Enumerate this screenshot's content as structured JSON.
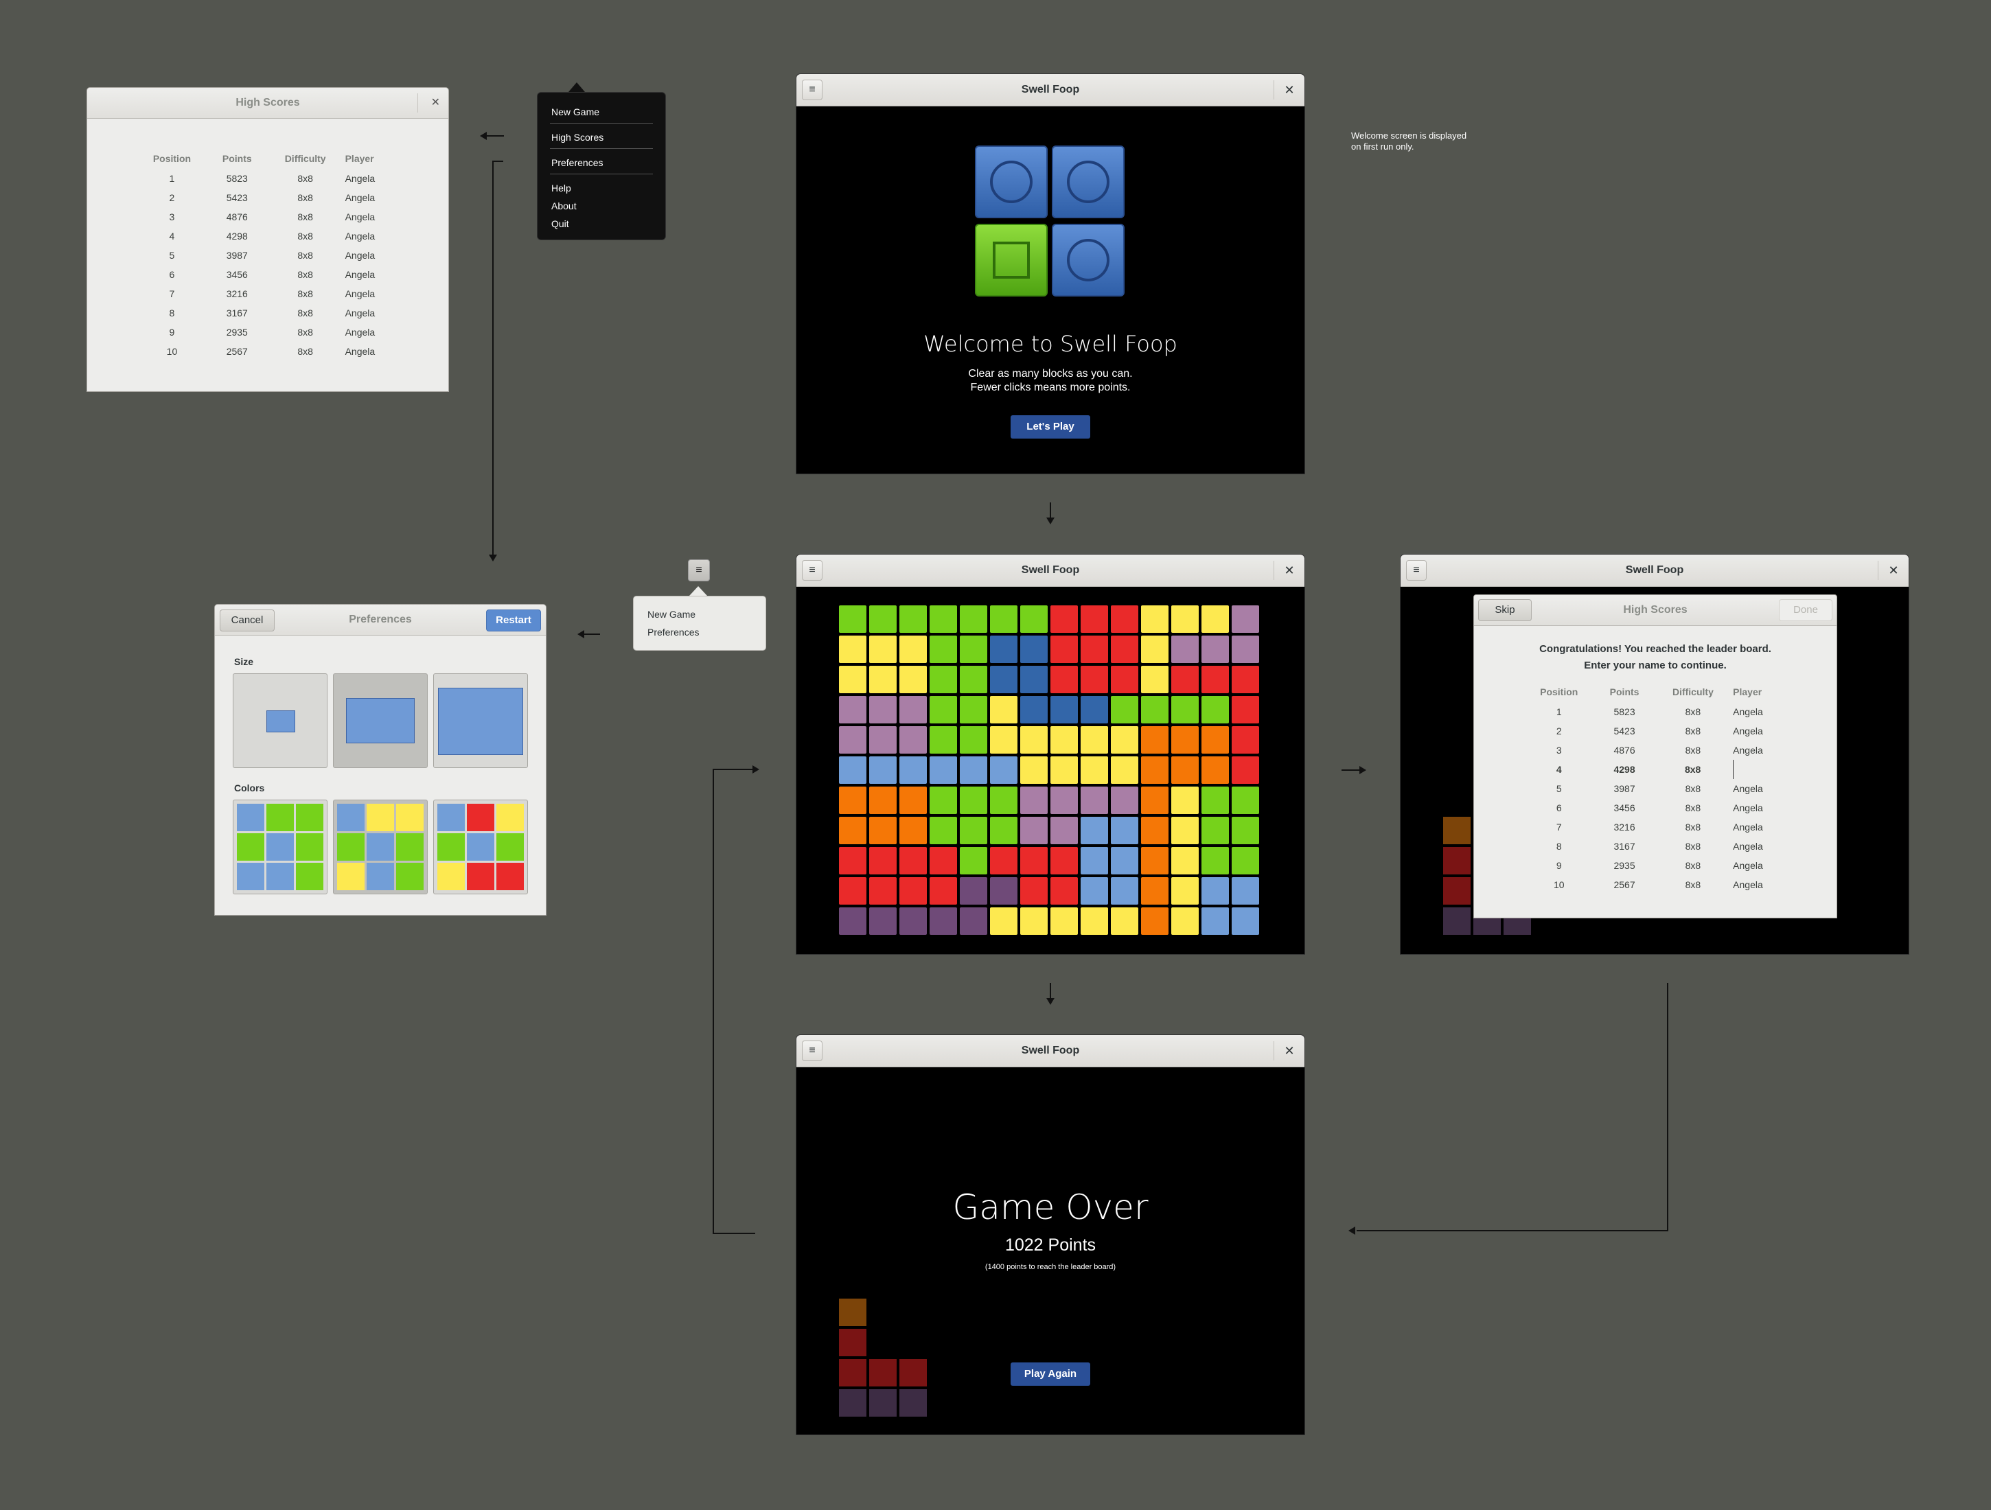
{
  "app": {
    "title": "Swell Foop"
  },
  "colors": {
    "green": "#76d21b",
    "blue": "#3366a9",
    "red": "#ea2a2a",
    "yellow": "#fde950",
    "purple": "#a97ea6",
    "lightblue": "#729ed7",
    "orange": "#f57706",
    "accent": "#2a4f97"
  },
  "main_menu": {
    "items": [
      "New Game",
      "High Scores",
      "Preferences",
      "Help",
      "About",
      "Quit"
    ]
  },
  "small_menu": {
    "items": [
      "New Game",
      "Preferences"
    ]
  },
  "high_scores": {
    "title": "High Scores",
    "columns": [
      "Position",
      "Points",
      "Difficulty",
      "Player"
    ],
    "rows": [
      [
        "1",
        "5823",
        "8x8",
        "Angela"
      ],
      [
        "2",
        "5423",
        "8x8",
        "Angela"
      ],
      [
        "3",
        "4876",
        "8x8",
        "Angela"
      ],
      [
        "4",
        "4298",
        "8x8",
        "Angela"
      ],
      [
        "5",
        "3987",
        "8x8",
        "Angela"
      ],
      [
        "6",
        "3456",
        "8x8",
        "Angela"
      ],
      [
        "7",
        "3216",
        "8x8",
        "Angela"
      ],
      [
        "8",
        "3167",
        "8x8",
        "Angela"
      ],
      [
        "9",
        "2935",
        "8x8",
        "Angela"
      ],
      [
        "10",
        "2567",
        "8x8",
        "Angela"
      ]
    ]
  },
  "welcome": {
    "heading": "Welcome to Swell Foop",
    "line1": "Clear as many blocks as you can.",
    "line2": "Fewer clicks means more points.",
    "button": "Let's Play"
  },
  "note": {
    "line1": "Welcome screen is displayed",
    "line2": "on first run only."
  },
  "preferences": {
    "title": "Preferences",
    "cancel": "Cancel",
    "restart": "Restart",
    "size_label": "Size",
    "colors_label": "Colors"
  },
  "leader": {
    "title": "High Scores",
    "skip": "Skip",
    "done": "Done",
    "message1": "Congratulations! You reached the leader board.",
    "message2": "Enter your name to continue.",
    "columns": [
      "Position",
      "Points",
      "Difficulty",
      "Player"
    ],
    "rows": [
      [
        "1",
        "5823",
        "8x8",
        "Angela"
      ],
      [
        "2",
        "5423",
        "8x8",
        "Angela"
      ],
      [
        "3",
        "4876",
        "8x8",
        "Angela"
      ],
      [
        "4",
        "4298",
        "8x8",
        ""
      ],
      [
        "5",
        "3987",
        "8x8",
        "Angela"
      ],
      [
        "6",
        "3456",
        "8x8",
        "Angela"
      ],
      [
        "7",
        "3216",
        "8x8",
        "Angela"
      ],
      [
        "8",
        "3167",
        "8x8",
        "Angela"
      ],
      [
        "9",
        "2935",
        "8x8",
        "Angela"
      ],
      [
        "10",
        "2567",
        "8x8",
        "Angela"
      ]
    ],
    "highlight_row": 4
  },
  "game_over": {
    "heading": "Game Over",
    "points": "1022 Points",
    "hint": "(1400 points to reach the leader board)",
    "button": "Play Again"
  },
  "board": {
    "rows": [
      "GGGGGGGRRRYYYP",
      "YYYGGBBRRRYPPP",
      "YYYGGBBRRRYRRR",
      "PPPGGYBBBGGGGR",
      "PPPGGYYYYYOOOR",
      "LLLLLLYYYYOOOR",
      "OOOGGGPPPPOYGG",
      "OOOGGGPPLLOYGG",
      "RRRRGRRRLLOYGG",
      "RRRRMMRRLLOYLL",
      "MMMMMYYYYYOYLL"
    ]
  }
}
